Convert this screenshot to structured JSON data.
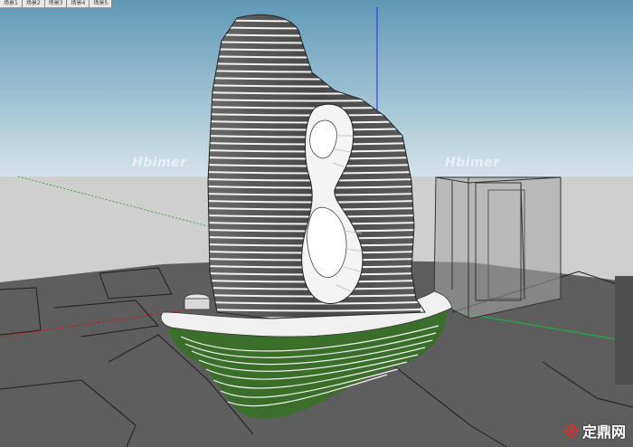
{
  "scene_tabs": [
    "场景1",
    "场景2",
    "场景3",
    "场景4",
    "场景5"
  ],
  "watermarks": [
    "Hbimer",
    "Hbimer"
  ],
  "logo": {
    "text": "定鼎网",
    "icon": "diamond-logo-icon"
  },
  "colors": {
    "sky_top": "#6ea2bd",
    "sky_bottom": "#c9dde7",
    "ground_far": "#c8c8c8",
    "ground_near": "#5f5f5f",
    "tower_dark": "#5a5a5a",
    "tower_line": "#f2f2f2",
    "void_white": "#f4f4f4",
    "podium_green": "#3d7a2a",
    "glass_block": "#9a9a9a",
    "axis_blue": "#2233cc",
    "axis_red": "#bb2222",
    "axis_green": "#22aa44",
    "logo_red": "#d9312b"
  }
}
